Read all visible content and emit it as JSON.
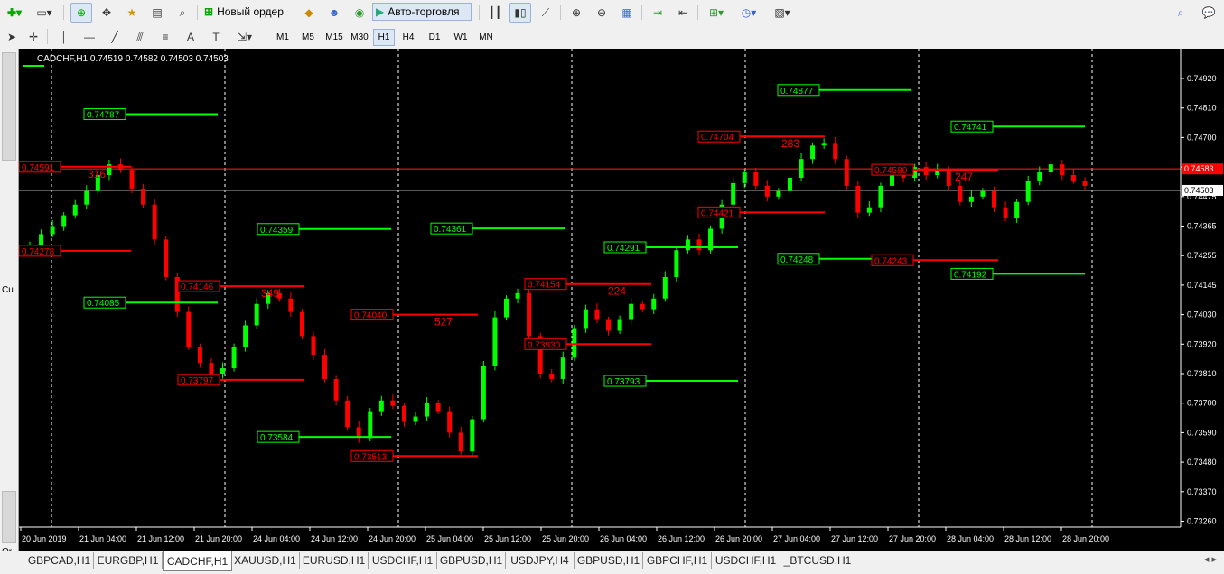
{
  "toolbar": {
    "new_order_label": "Новый ордер",
    "autotrading_label": "Авто-торговля",
    "timeframes": [
      "M1",
      "M5",
      "M15",
      "M30",
      "H1",
      "H4",
      "D1",
      "W1",
      "MN"
    ],
    "active_timeframe": "H1"
  },
  "chart": {
    "header": "CADCHF,H1  0.74519 0.74582 0.74503 0.74503",
    "current_price": "0.74503",
    "bid_label": "0.74583",
    "price_ticks": [
      "0.74920",
      "0.74810",
      "0.74700",
      "0.74590",
      "0.74475",
      "0.74365",
      "0.74255",
      "0.74145",
      "0.74030",
      "0.73920",
      "0.73810",
      "0.73700",
      "0.73590",
      "0.73480",
      "0.73370",
      "0.73260"
    ],
    "time_ticks": [
      "20 Jun 2019",
      "21 Jun 04:00",
      "21 Jun 12:00",
      "21 Jun 20:00",
      "24 Jun 04:00",
      "24 Jun 12:00",
      "24 Jun 20:00",
      "25 Jun 04:00",
      "25 Jun 12:00",
      "25 Jun 20:00",
      "26 Jun 04:00",
      "26 Jun 12:00",
      "26 Jun 20:00",
      "27 Jun 04:00",
      "27 Jun 12:00",
      "27 Jun 20:00",
      "28 Jun 04:00",
      "28 Jun 12:00",
      "28 Jun 20:00"
    ],
    "green_levels": [
      {
        "label": "0.74787"
      },
      {
        "label": "0.74085"
      },
      {
        "label": "0.74359"
      },
      {
        "label": "0.73584"
      },
      {
        "label": "0.74361"
      },
      {
        "label": "0.74291"
      },
      {
        "label": "0.73793"
      },
      {
        "label": "0.74877"
      },
      {
        "label": "0.74248"
      },
      {
        "label": "0.74741"
      },
      {
        "label": "0.74192"
      }
    ],
    "red_levels": [
      {
        "label": "0.74591"
      },
      {
        "label": "0.74278"
      },
      {
        "label": "0.74146"
      },
      {
        "label": "0.73797"
      },
      {
        "label": "0.74040"
      },
      {
        "label": "0.73513"
      },
      {
        "label": "0.74154"
      },
      {
        "label": "0.73930"
      },
      {
        "label": "0.74704"
      },
      {
        "label": "0.74421"
      },
      {
        "label": "0.74580"
      },
      {
        "label": "0.74243"
      }
    ],
    "range_counts": [
      "316",
      "349",
      "527",
      "224",
      "283",
      "247"
    ]
  },
  "tabs": [
    "GBPCAD,H1",
    "EURGBP,H1",
    "CADCHF,H1",
    "XAUUSD,H1",
    "EURUSD,H1",
    "USDCHF,H1",
    "GBPUSD,H1",
    "USDJPY,H4",
    "GBPUSD,H1",
    "GBPCHF,H1",
    "USDCHF,H1",
    "_BTCUSD,H1"
  ],
  "active_tab": "CADCHF,H1",
  "left_labels": [
    "Cu",
    "Or"
  ],
  "colors": {
    "bull": "#00ff00",
    "bear": "#ff0000",
    "grid": "#ffffff",
    "bg": "#000000",
    "axis_text": "#ffffff"
  }
}
